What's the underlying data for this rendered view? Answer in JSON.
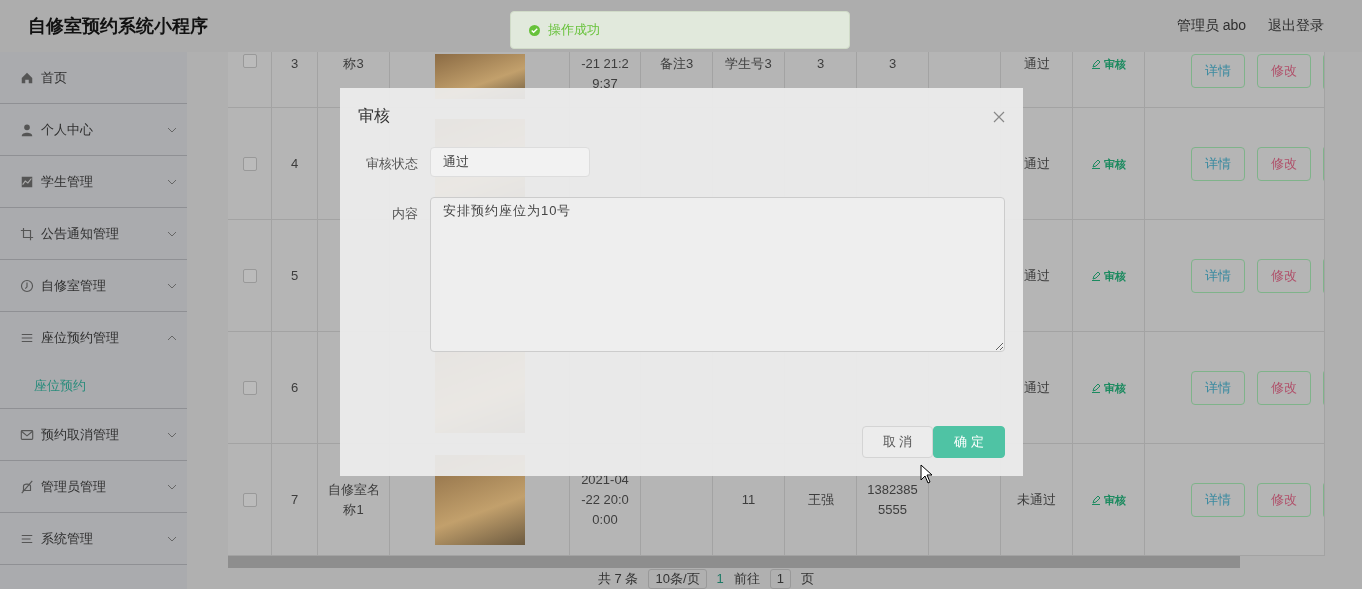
{
  "header": {
    "title": "自修室预约系统小程序",
    "user": "管理员 abo",
    "logout": "退出登录"
  },
  "toast": {
    "message": "操作成功"
  },
  "sidebar": {
    "items": [
      {
        "label": "首页",
        "kind": "link"
      },
      {
        "label": "个人中心",
        "kind": "group",
        "expanded": false
      },
      {
        "label": "学生管理",
        "kind": "group",
        "expanded": false
      },
      {
        "label": "公告通知管理",
        "kind": "group",
        "expanded": false
      },
      {
        "label": "自修室管理",
        "kind": "group",
        "expanded": false
      },
      {
        "label": "座位预约管理",
        "kind": "group",
        "expanded": true,
        "children": [
          {
            "label": "座位预约",
            "selected": true
          }
        ]
      },
      {
        "label": "预约取消管理",
        "kind": "group",
        "expanded": false
      },
      {
        "label": "管理员管理",
        "kind": "group",
        "expanded": false
      },
      {
        "label": "系统管理",
        "kind": "group",
        "expanded": false
      }
    ]
  },
  "table": {
    "rows": [
      {
        "checked": false,
        "index": "3",
        "name": "称3",
        "time": "-21 21:29:37",
        "remark": "备注3",
        "student_no": "学生号3",
        "student_name": "3",
        "phone": "3",
        "status": "通过",
        "audit": "审核",
        "actions": [
          "详情",
          "修改"
        ]
      },
      {
        "checked": false,
        "index": "4",
        "status": "通过",
        "audit": "审核",
        "actions": [
          "详情",
          "修改"
        ]
      },
      {
        "checked": false,
        "index": "5",
        "status": "通过",
        "audit": "审核",
        "actions": [
          "详情",
          "修改"
        ]
      },
      {
        "checked": false,
        "index": "6",
        "status": "通过",
        "audit": "审核",
        "actions": [
          "详情",
          "修改"
        ]
      },
      {
        "checked": false,
        "index": "7",
        "name": "自修室名称1",
        "time": "2021-04-22 20:00:00",
        "student_no": "11",
        "student_name": "王强",
        "phone": "13823855555",
        "status": "未通过",
        "audit": "审核",
        "actions": [
          "详情",
          "修改"
        ]
      }
    ]
  },
  "pagination": {
    "total": "共 7 条",
    "page_size": "10条/页",
    "current": "1",
    "goto": "前往",
    "goto_value": "1",
    "suffix": "页"
  },
  "dialog": {
    "title": "审核",
    "fields": [
      {
        "label": "审核状态",
        "kind": "select",
        "value": "通过"
      },
      {
        "label": "内容",
        "kind": "textarea",
        "value": "安排预约座位为10号"
      }
    ],
    "buttons": [
      {
        "label": "取 消",
        "kind": "default"
      },
      {
        "label": "确 定",
        "kind": "primary"
      }
    ]
  }
}
